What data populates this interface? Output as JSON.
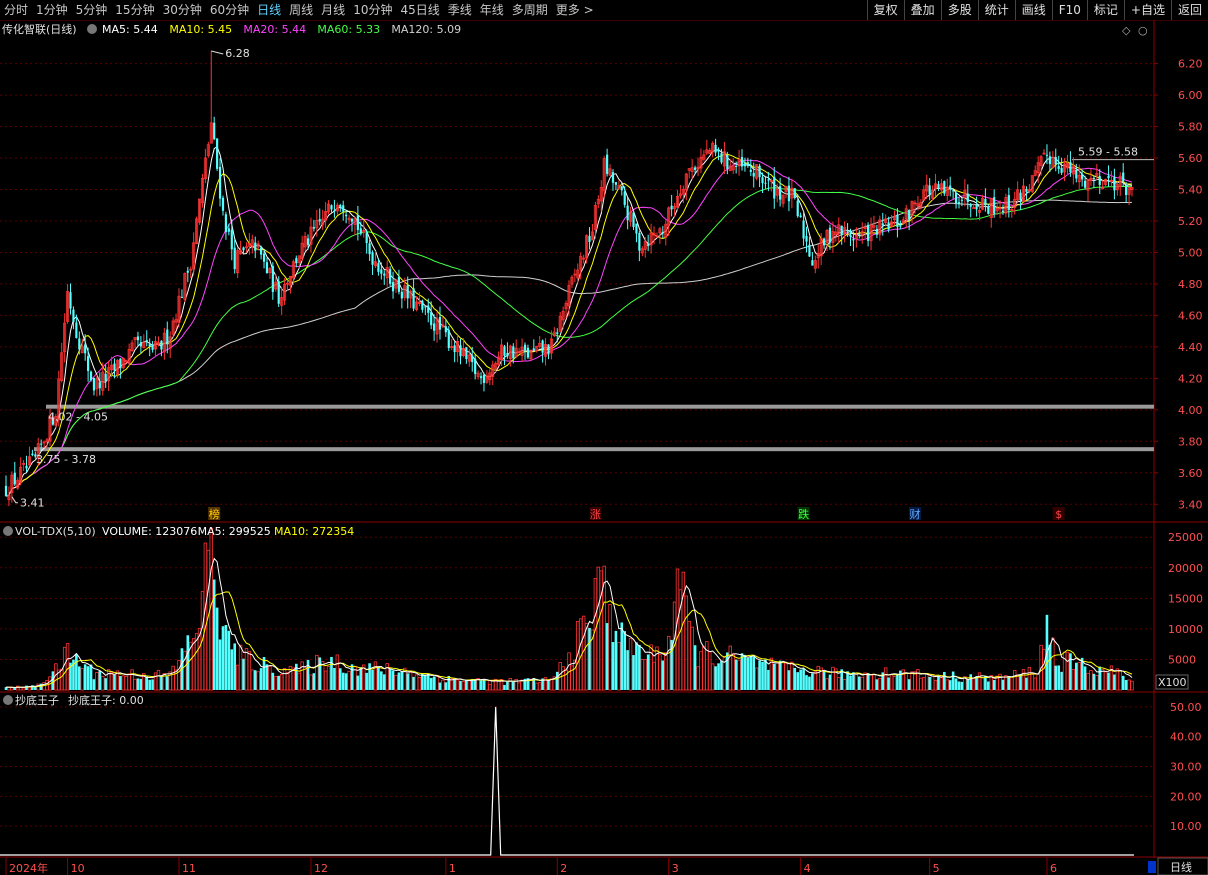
{
  "toolbar": {
    "periods": [
      {
        "label": "分时"
      },
      {
        "label": "1分钟"
      },
      {
        "label": "5分钟"
      },
      {
        "label": "15分钟"
      },
      {
        "label": "30分钟"
      },
      {
        "label": "60分钟"
      },
      {
        "label": "日线",
        "active": true
      },
      {
        "label": "周线"
      },
      {
        "label": "月线"
      },
      {
        "label": "10分钟"
      },
      {
        "label": "45日线"
      },
      {
        "label": "季线"
      },
      {
        "label": "年线"
      },
      {
        "label": "多周期"
      },
      {
        "label": "更多 >"
      }
    ],
    "tools": [
      {
        "label": "复权"
      },
      {
        "label": "叠加"
      },
      {
        "label": "多股"
      },
      {
        "label": "统计"
      },
      {
        "label": "画线"
      },
      {
        "label": "F10"
      },
      {
        "label": "标记"
      },
      {
        "label": "+自选"
      },
      {
        "label": "返回"
      }
    ]
  },
  "price_panel": {
    "title": "传化智联(日线)",
    "ma_labels": [
      {
        "text": "MA5: 5.44",
        "color": "#ffffff"
      },
      {
        "text": "MA10: 5.45",
        "color": "#ffff00"
      },
      {
        "text": "MA20: 5.44",
        "color": "#ff44ff"
      },
      {
        "text": "MA60: 5.33",
        "color": "#44ff44"
      },
      {
        "text": "MA120: 5.09",
        "color": "#d0d0d0"
      }
    ],
    "high_label": "6.28",
    "low_label": "3.41",
    "range_labels": [
      {
        "text": "4.02 - 4.05",
        "price": 4.02
      },
      {
        "text": "3.75 - 3.78",
        "price": 3.75
      },
      {
        "text": "5.59 - 5.58",
        "price": 5.59
      }
    ],
    "event_markers": [
      {
        "text": "榜",
        "color": "#ffcc00",
        "bg": "#553300",
        "day": 71
      },
      {
        "text": "涨",
        "color": "#ff4444",
        "bg": "#330000",
        "day": 201
      },
      {
        "text": "跌",
        "color": "#44ff44",
        "bg": "#003300",
        "day": 272
      },
      {
        "text": "财",
        "color": "#66aaff",
        "bg": "#001a44",
        "day": 310
      },
      {
        "text": "$",
        "color": "#ff4444",
        "bg": "#330000",
        "day": 359
      }
    ]
  },
  "volume_panel": {
    "title": "VOL-TDX(5,10)",
    "labels": [
      {
        "text": "VOLUME: 123076",
        "color": "#ffffff"
      },
      {
        "text": "MA5: 299525",
        "color": "#ffffff"
      },
      {
        "text": "MA10: 272354",
        "color": "#ffff00"
      }
    ],
    "unit_label": "X100"
  },
  "indicator_panel": {
    "title": "抄底王子",
    "value_label": "抄底王子: 0.00"
  },
  "chart_data": [
    {
      "type": "candlestick",
      "title": "传化智联(日线)",
      "ylim": [
        3.3,
        6.35
      ],
      "yticks": [
        3.4,
        3.6,
        3.8,
        4.0,
        4.2,
        4.4,
        4.6,
        4.8,
        5.0,
        5.2,
        5.4,
        5.6,
        5.8,
        6.0,
        6.2
      ],
      "x_tick_labels": [
        {
          "label": "2024年",
          "day": 0
        },
        {
          "label": "10",
          "day": 21
        },
        {
          "label": "11",
          "day": 59
        },
        {
          "label": "12",
          "day": 104
        },
        {
          "label": "1",
          "day": 150
        },
        {
          "label": "2",
          "day": 188
        },
        {
          "label": "3",
          "day": 226
        },
        {
          "label": "4",
          "day": 271
        },
        {
          "label": "5",
          "day": 315
        },
        {
          "label": "6",
          "day": 355
        }
      ],
      "x_range": [
        0,
        384
      ],
      "anchors": [
        [
          0,
          3.5
        ],
        [
          10,
          3.68
        ],
        [
          17,
          4.0
        ],
        [
          21,
          4.75
        ],
        [
          24,
          4.5
        ],
        [
          30,
          4.15
        ],
        [
          37,
          4.25
        ],
        [
          44,
          4.4
        ],
        [
          52,
          4.38
        ],
        [
          56,
          4.5
        ],
        [
          63,
          4.95
        ],
        [
          70,
          5.82
        ],
        [
          74,
          5.25
        ],
        [
          78,
          4.95
        ],
        [
          85,
          5.05
        ],
        [
          93,
          4.72
        ],
        [
          100,
          5.0
        ],
        [
          107,
          5.18
        ],
        [
          113,
          5.35
        ],
        [
          118,
          5.25
        ],
        [
          124,
          5.0
        ],
        [
          130,
          4.85
        ],
        [
          138,
          4.7
        ],
        [
          146,
          4.55
        ],
        [
          154,
          4.38
        ],
        [
          162,
          4.2
        ],
        [
          170,
          4.38
        ],
        [
          179,
          4.35
        ],
        [
          186,
          4.4
        ],
        [
          193,
          4.8
        ],
        [
          200,
          5.15
        ],
        [
          204,
          5.55
        ],
        [
          210,
          5.35
        ],
        [
          216,
          5.05
        ],
        [
          224,
          5.15
        ],
        [
          232,
          5.5
        ],
        [
          240,
          5.65
        ],
        [
          248,
          5.55
        ],
        [
          256,
          5.5
        ],
        [
          262,
          5.4
        ],
        [
          268,
          5.35
        ],
        [
          275,
          4.95
        ],
        [
          282,
          5.15
        ],
        [
          290,
          5.1
        ],
        [
          298,
          5.15
        ],
        [
          306,
          5.2
        ],
        [
          313,
          5.4
        ],
        [
          320,
          5.38
        ],
        [
          328,
          5.35
        ],
        [
          335,
          5.3
        ],
        [
          342,
          5.3
        ],
        [
          350,
          5.45
        ],
        [
          355,
          5.62
        ],
        [
          361,
          5.55
        ],
        [
          367,
          5.45
        ],
        [
          372,
          5.48
        ],
        [
          378,
          5.45
        ],
        [
          384,
          5.4
        ]
      ],
      "ma_final": {
        "MA5": 5.44,
        "MA10": 5.45,
        "MA20": 5.44,
        "MA60": 5.33,
        "MA120": 5.09
      },
      "high": 6.28,
      "low": 3.41
    },
    {
      "type": "bar",
      "title": "VOL-TDX(5,10)",
      "ylim": [
        0,
        27000
      ],
      "yticks": [
        5000,
        10000,
        15000,
        20000,
        25000
      ],
      "volume_anchors": [
        [
          0,
          400
        ],
        [
          10,
          700
        ],
        [
          17,
          3500
        ],
        [
          21,
          6500
        ],
        [
          30,
          3200
        ],
        [
          45,
          2800
        ],
        [
          56,
          2600
        ],
        [
          63,
          9000
        ],
        [
          66,
          14000
        ],
        [
          68,
          20000
        ],
        [
          70,
          26500
        ],
        [
          74,
          10000
        ],
        [
          80,
          6000
        ],
        [
          90,
          4000
        ],
        [
          100,
          3500
        ],
        [
          110,
          5500
        ],
        [
          120,
          4000
        ],
        [
          135,
          3500
        ],
        [
          150,
          2000
        ],
        [
          170,
          1500
        ],
        [
          186,
          1800
        ],
        [
          192,
          6000
        ],
        [
          200,
          14000
        ],
        [
          203,
          19500
        ],
        [
          210,
          9000
        ],
        [
          220,
          6000
        ],
        [
          226,
          8500
        ],
        [
          229,
          19800
        ],
        [
          235,
          7000
        ],
        [
          250,
          5500
        ],
        [
          265,
          3800
        ],
        [
          275,
          3500
        ],
        [
          285,
          2800
        ],
        [
          300,
          3200
        ],
        [
          320,
          2500
        ],
        [
          340,
          2200
        ],
        [
          352,
          3500
        ],
        [
          355,
          12300
        ],
        [
          358,
          5500
        ],
        [
          370,
          4000
        ],
        [
          380,
          3000
        ],
        [
          384,
          1200
        ]
      ]
    },
    {
      "type": "line",
      "title": "抄底王子",
      "ylim": [
        0,
        54
      ],
      "yticks": [
        10.0,
        20.0,
        30.0,
        40.0,
        50.0
      ],
      "spikes": [
        {
          "day": 167,
          "value": 50
        }
      ]
    }
  ]
}
